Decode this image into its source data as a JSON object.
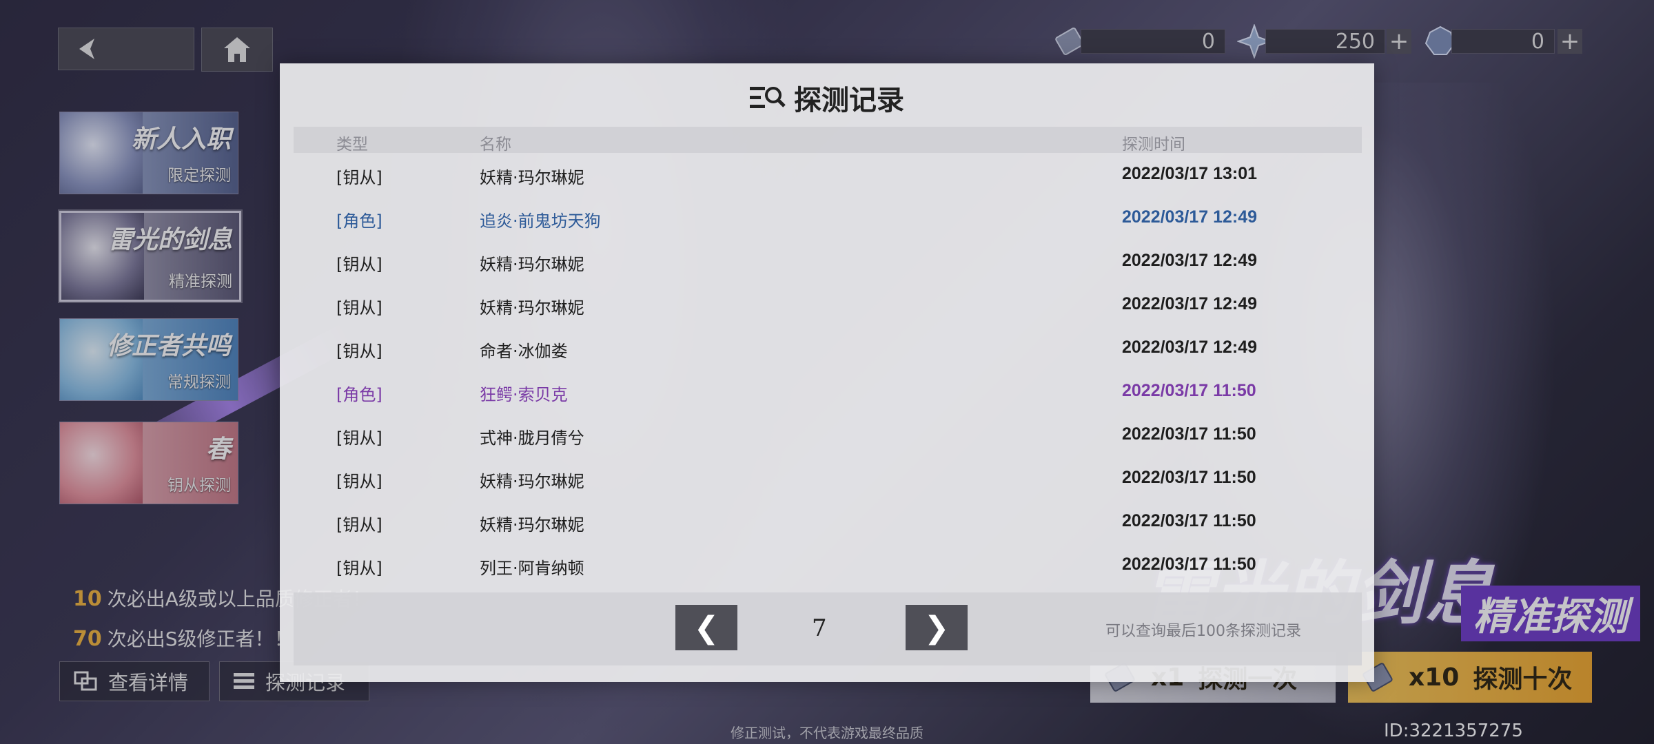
{
  "topbar": {
    "currencies": [
      {
        "icon": "ticket-icon",
        "value": "0",
        "has_plus": false
      },
      {
        "icon": "crystal-icon",
        "value": "250",
        "has_plus": true
      },
      {
        "icon": "gem-icon",
        "value": "0",
        "has_plus": true
      }
    ],
    "plus": "+"
  },
  "side_banners": [
    {
      "title": "新人入职",
      "subtitle": "限定探测",
      "selected": false
    },
    {
      "title": "雷光的剑息",
      "subtitle": "精准探测",
      "selected": true
    },
    {
      "title": "修正者共鸣",
      "subtitle": "常规探测",
      "selected": false
    },
    {
      "title": "春",
      "subtitle": "钥从探测",
      "selected": false
    }
  ],
  "pity": [
    {
      "count": "10",
      "text": "次必出A级或以上品质修正者！"
    },
    {
      "count": "70",
      "text": "次必出S级修正者！！"
    }
  ],
  "bottom_buttons": {
    "details": "查看详情",
    "records": "探测记录"
  },
  "draw_buttons": {
    "single_count": "x1",
    "single_label": "探测一次",
    "ten_count": "x10",
    "ten_label": "探测十次"
  },
  "banner": {
    "title": "雷光的剑息",
    "subtitle": "精准探测"
  },
  "footer_note": "修正测试，不代表游戏最终品质",
  "user_id": "ID:3221357275",
  "modal": {
    "title": "探测记录",
    "headers": {
      "type": "类型",
      "name": "名称",
      "time": "探测时间"
    },
    "rows": [
      {
        "type": "[钥从]",
        "name": "妖精·玛尔琳妮",
        "time": "2022/03/17 13:01",
        "style": "normal"
      },
      {
        "type": "[角色]",
        "name": "追炎·前鬼坊天狗",
        "time": "2022/03/17 12:49",
        "style": "blue"
      },
      {
        "type": "[钥从]",
        "name": "妖精·玛尔琳妮",
        "time": "2022/03/17 12:49",
        "style": "normal"
      },
      {
        "type": "[钥从]",
        "name": "妖精·玛尔琳妮",
        "time": "2022/03/17 12:49",
        "style": "normal"
      },
      {
        "type": "[钥从]",
        "name": "命者·冰伽娄",
        "time": "2022/03/17 12:49",
        "style": "normal"
      },
      {
        "type": "[角色]",
        "name": "狂鳄·索贝克",
        "time": "2022/03/17 11:50",
        "style": "purple"
      },
      {
        "type": "[钥从]",
        "name": "式神·胧月倩兮",
        "time": "2022/03/17 11:50",
        "style": "normal"
      },
      {
        "type": "[钥从]",
        "name": "妖精·玛尔琳妮",
        "time": "2022/03/17 11:50",
        "style": "normal"
      },
      {
        "type": "[钥从]",
        "name": "妖精·玛尔琳妮",
        "time": "2022/03/17 11:50",
        "style": "normal"
      },
      {
        "type": "[钥从]",
        "name": "列王·阿肯纳顿",
        "time": "2022/03/17 11:50",
        "style": "normal"
      }
    ],
    "pager": {
      "prev": "❮",
      "next": "❯",
      "page": "7",
      "note": "可以查询最后100条探测记录"
    }
  },
  "colors": {
    "rare_blue": "#2d5a98",
    "rare_purple": "#7a3aa6",
    "accent_gold": "#f2b63f"
  }
}
